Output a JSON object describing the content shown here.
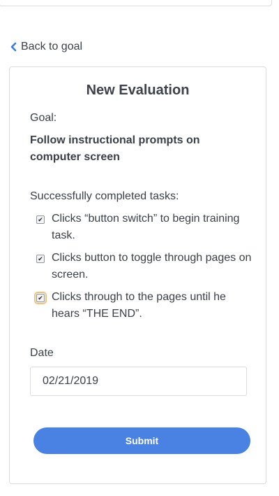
{
  "nav": {
    "back_label": "Back to goal",
    "back_icon": "chevron-left-icon",
    "accent_color": "#3a7be0"
  },
  "form": {
    "title": "New Evaluation",
    "goal_label": "Goal:",
    "goal_text": "Follow instructional prompts on computer screen",
    "tasks_label": "Successfully completed tasks:",
    "tasks": [
      {
        "label": "Clicks “button switch” to begin training task.",
        "checked": true
      },
      {
        "label": "Clicks button to toggle through pages on screen.",
        "checked": true
      },
      {
        "label": "Clicks through to the pages until he hears “THE END”.",
        "checked": true
      }
    ],
    "date_label": "Date",
    "date_value": "02/21/2019",
    "submit_label": "Submit",
    "submit_color": "#4a82e4"
  }
}
